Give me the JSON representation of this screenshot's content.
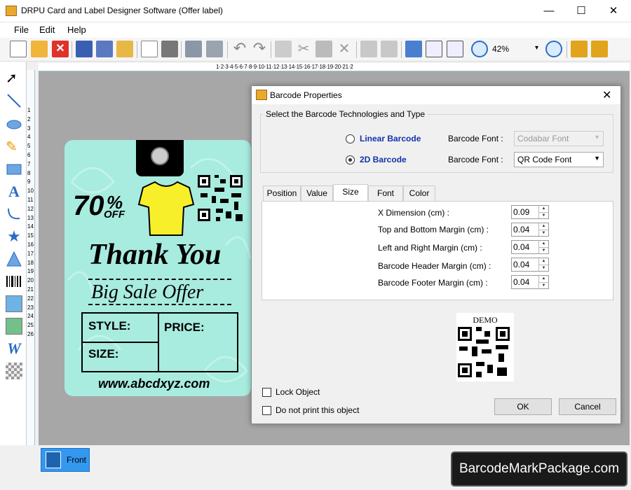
{
  "window": {
    "title": "DRPU Card and Label Designer Software (Offer label)",
    "minimize": "—",
    "maximize": "☐",
    "close": "✕"
  },
  "menu": {
    "file": "File",
    "edit": "Edit",
    "help": "Help"
  },
  "toolbar": {
    "zoom": "42%",
    "zoom_arrow": "▾"
  },
  "ruler": {
    "h": "1·2·3·4·5·6·7·8·9·10·11·12·13·14·15·16·17·18·19·20·21·2",
    "v": "1 2 3 4 5 6 7 8 9 10 11 12 13 14 15 16 17 18 19 20 21 22 23 24 25 26"
  },
  "card": {
    "discount_big": "70",
    "discount_sym": "%",
    "discount_off": "OFF",
    "thank_you": "Thank You",
    "big_sale": "Big Sale Offer",
    "style": "STYLE:",
    "price": "PRICE:",
    "size": "SIZE:",
    "website": "www.abcdxyz.com"
  },
  "bottom": {
    "front_tab": "Front",
    "brand": "BarcodeMarkPackage.com"
  },
  "dialog": {
    "title": "Barcode Properties",
    "group_title": "Select the Barcode Technologies and Type",
    "linear": "Linear Barcode",
    "twod": "2D Barcode",
    "font_label": "Barcode Font :",
    "linear_font": "Codabar Font",
    "twod_font": "QR Code Font",
    "tabs": [
      "Position",
      "Value",
      "Size",
      "Font",
      "Color"
    ],
    "fields": [
      {
        "label": "X Dimension (cm) :",
        "value": "0.09"
      },
      {
        "label": "Top and Bottom Margin (cm) :",
        "value": "0.04"
      },
      {
        "label": "Left and Right Margin (cm) :",
        "value": "0.04"
      },
      {
        "label": "Barcode Header Margin (cm) :",
        "value": "0.04"
      },
      {
        "label": "Barcode Footer Margin (cm) :",
        "value": "0.04"
      }
    ],
    "demo": "DEMO",
    "lock": "Lock Object",
    "noprint": "Do not print this object",
    "ok": "OK",
    "cancel": "Cancel"
  },
  "colors": {
    "card_bg": "#a8ebdf",
    "tshirt": "#f7ef2a",
    "front_tab": "#3398f0",
    "link_blue": "#1133aa"
  },
  "icons": [
    "select-icon",
    "line-icon",
    "ellipse-icon",
    "pencil-icon",
    "rectangle-icon",
    "text-icon",
    "curve-icon",
    "star-icon",
    "triangle-icon",
    "barcode-icon",
    "image-icon",
    "image-library-icon",
    "word-art-icon",
    "pattern-icon"
  ]
}
